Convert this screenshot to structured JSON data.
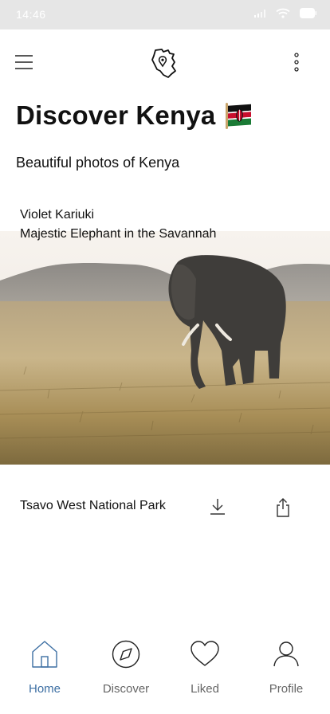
{
  "status_bar": {
    "time": "14:46",
    "icons": [
      "signal-icon",
      "wifi-icon",
      "battery-icon"
    ]
  },
  "header": {
    "menu_icon": "hamburger-menu-icon",
    "logo_icon": "kenya-map-pin-logo-icon",
    "more_icon": "more-vertical-icon"
  },
  "page": {
    "title": "Discover Kenya",
    "title_icon": "kenya-flag-icon",
    "subtitle": "Beautiful photos of Kenya"
  },
  "photo_card": {
    "author": "Violet Kariuki",
    "caption": "Majestic Elephant in the Savannah",
    "location": "Tsavo West National Park",
    "download_icon": "download-icon",
    "share_icon": "share-icon"
  },
  "tab_bar": {
    "tabs": [
      {
        "label": "Home",
        "icon": "home-icon",
        "active": true
      },
      {
        "label": "Discover",
        "icon": "compass-icon",
        "active": false
      },
      {
        "label": "Liked",
        "icon": "heart-icon",
        "active": false
      },
      {
        "label": "Profile",
        "icon": "user-icon",
        "active": false
      }
    ]
  },
  "colors": {
    "accent": "#3d6fa3",
    "status_bar_bg": "#e6e6e6",
    "text": "#111111",
    "tab_inactive": "#666666"
  }
}
